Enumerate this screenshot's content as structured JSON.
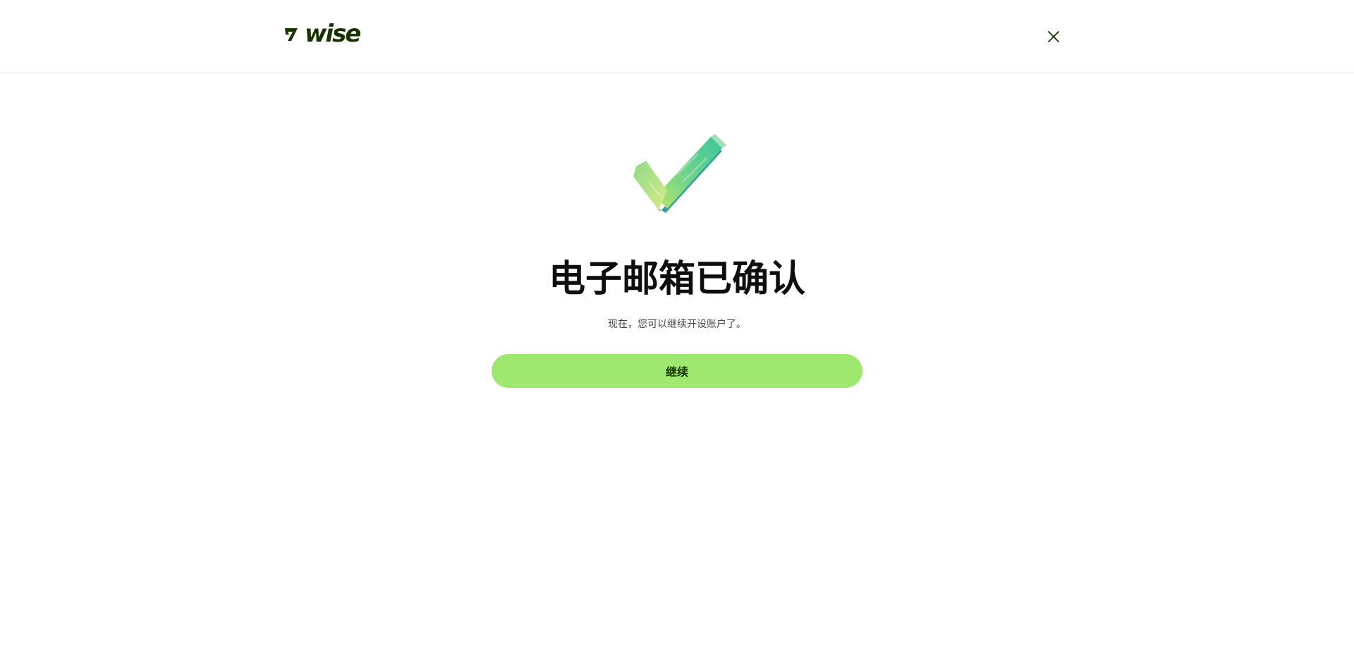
{
  "header": {
    "logo_text": "wise",
    "logo_icon": "wise-flag-icon",
    "close_icon": "close-icon"
  },
  "main": {
    "illustration_icon": "green-checkmark-icon",
    "title": "电子邮箱已确认",
    "subtitle": "现在，您可以继续开设账户了。",
    "continue_label": "继续"
  },
  "colors": {
    "brand_dark_green": "#163300",
    "primary_button_bg": "#9fe870",
    "divider": "#e5e6e3",
    "background": "#ffffff"
  }
}
